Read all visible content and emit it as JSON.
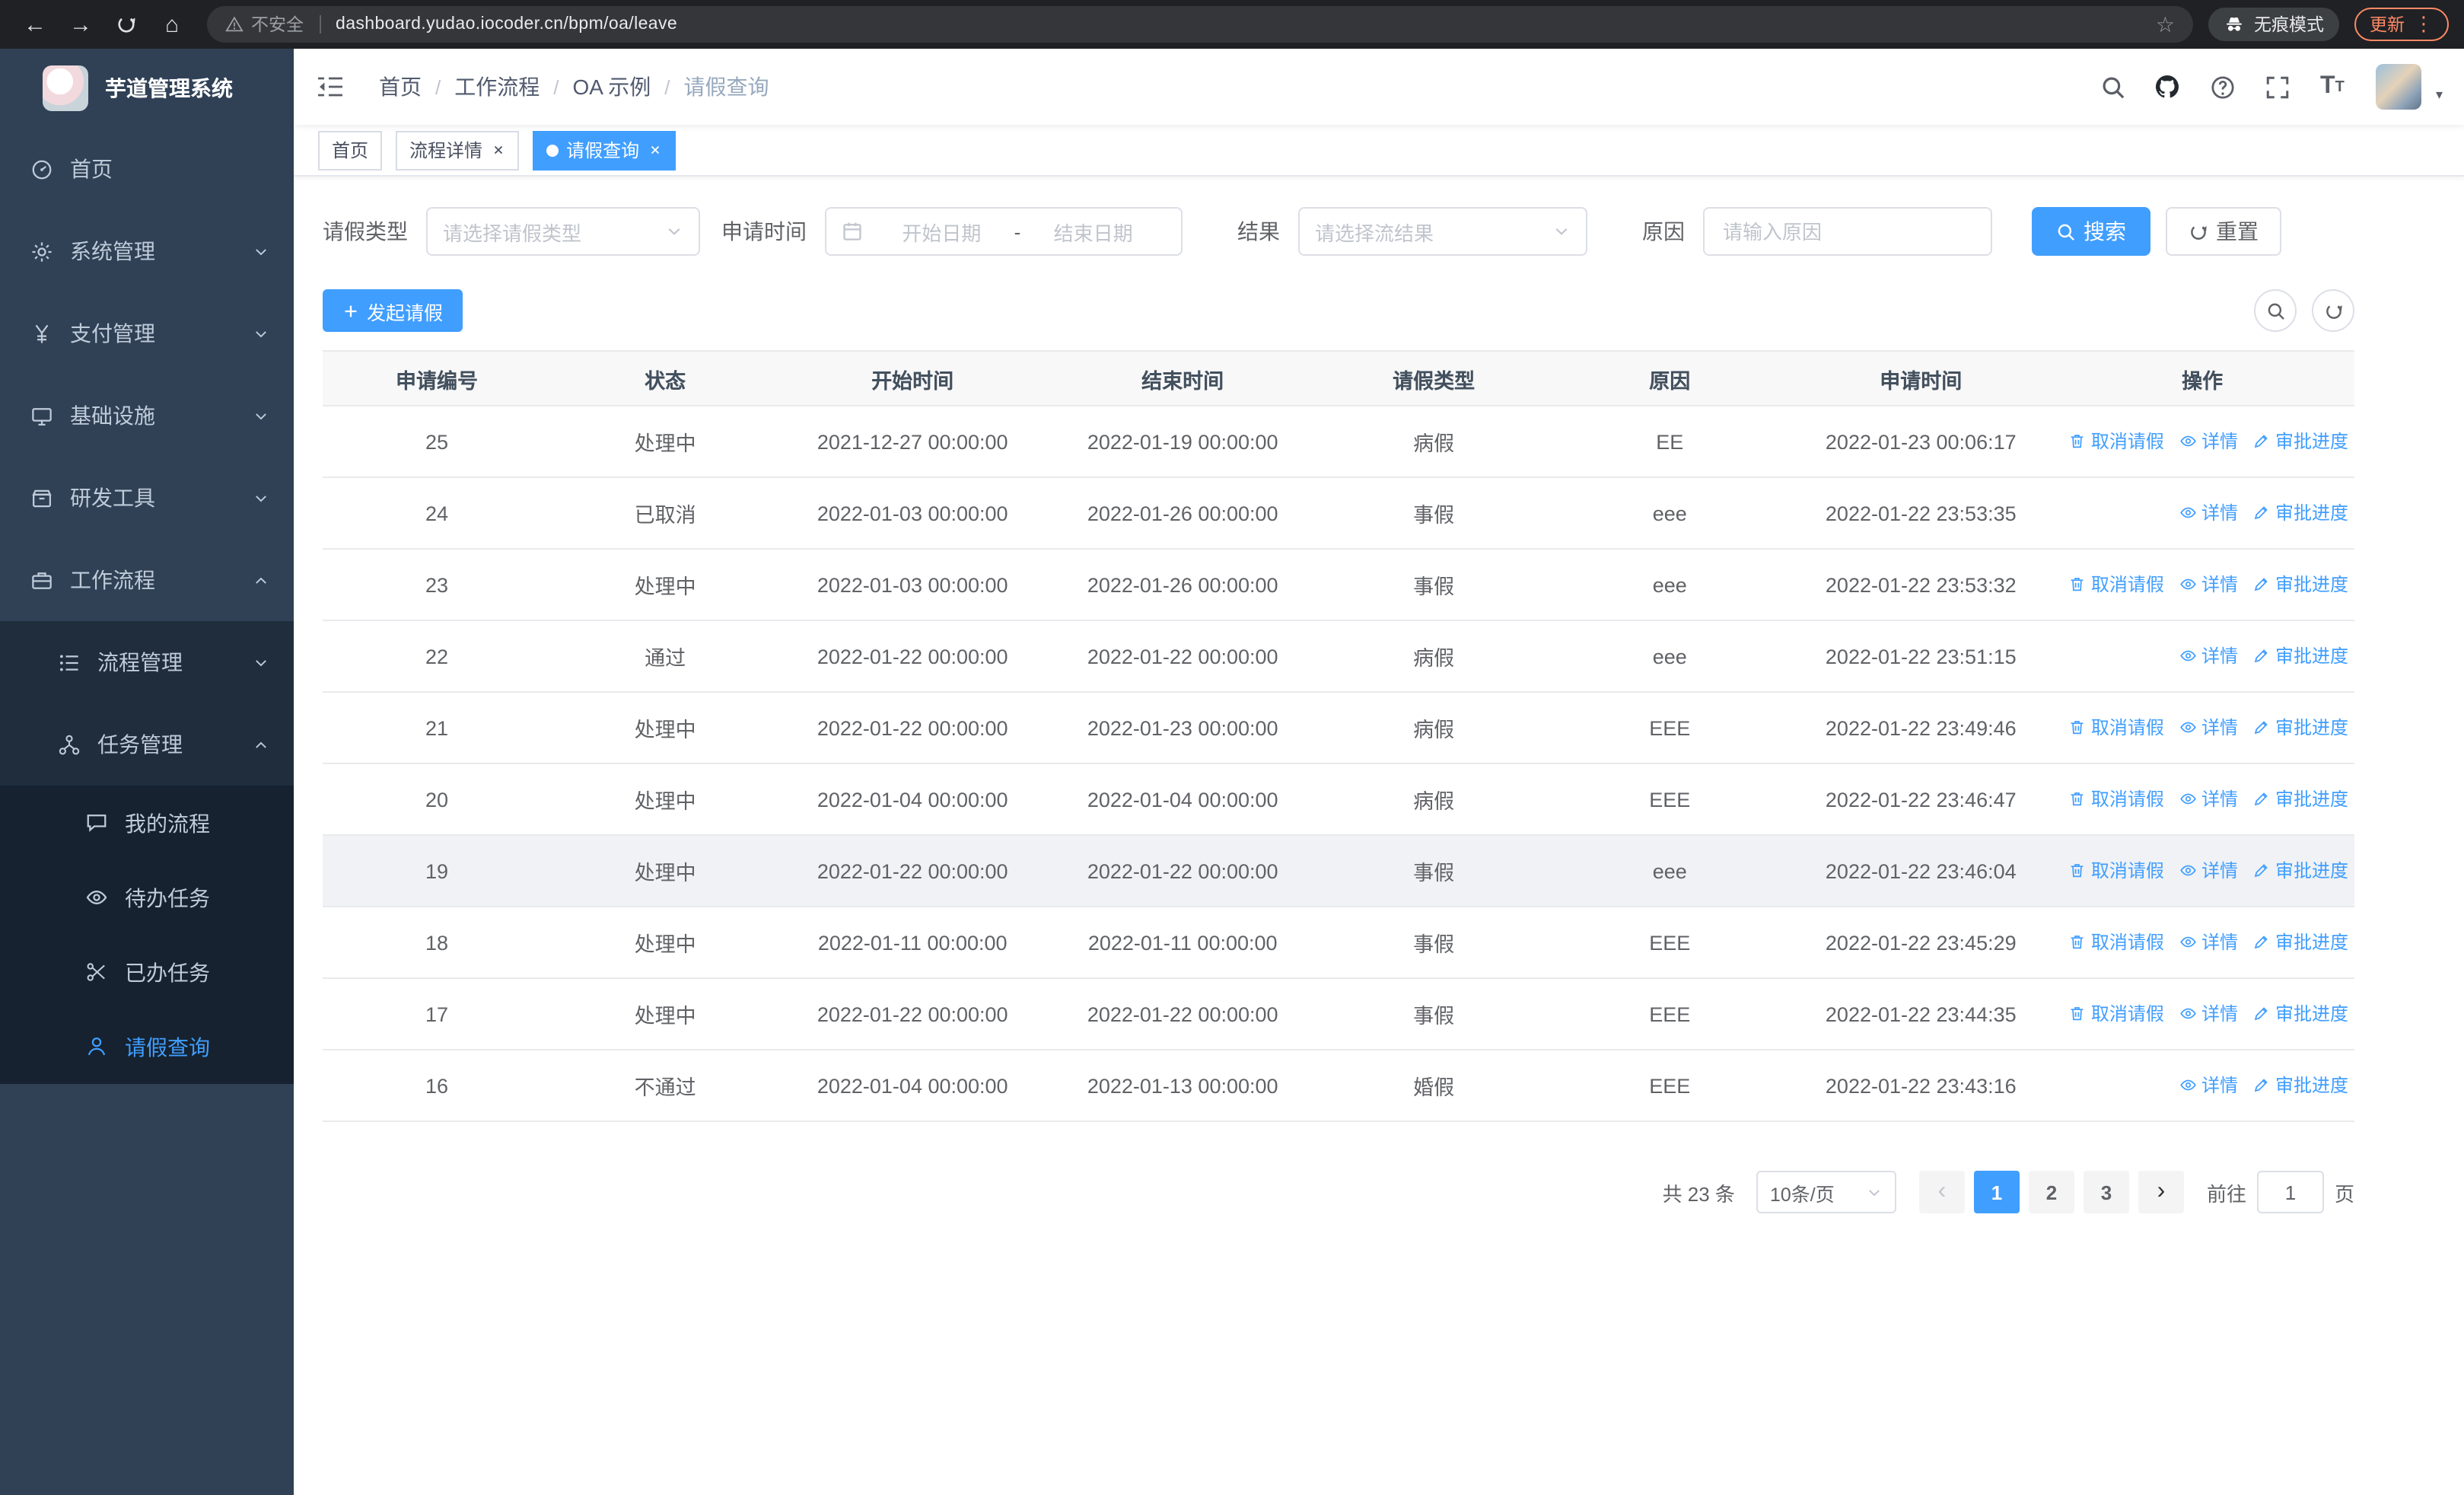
{
  "browser": {
    "security_label": "不安全",
    "url": "dashboard.yudao.iocoder.cn/bpm/oa/leave",
    "incognito_label": "无痕模式",
    "update_label": "更新"
  },
  "sidebar": {
    "logo_title": "芋道管理系统",
    "menu": [
      {
        "label": "首页",
        "icon": "dashboard-icon",
        "level": 1
      },
      {
        "label": "系统管理",
        "icon": "gear-icon",
        "level": 1,
        "chevron": "down"
      },
      {
        "label": "支付管理",
        "icon": "yen-icon",
        "level": 1,
        "chevron": "down"
      },
      {
        "label": "基础设施",
        "icon": "monitor-icon",
        "level": 1,
        "chevron": "down"
      },
      {
        "label": "研发工具",
        "icon": "tools-icon",
        "level": 1,
        "chevron": "down"
      },
      {
        "label": "工作流程",
        "icon": "workflow-icon",
        "level": 1,
        "chevron": "up"
      },
      {
        "label": "流程管理",
        "icon": "process-icon",
        "level": 2,
        "chevron": "down"
      },
      {
        "label": "任务管理",
        "icon": "task-icon",
        "level": 2,
        "chevron": "up"
      },
      {
        "label": "我的流程",
        "icon": "chat-icon",
        "level": 3
      },
      {
        "label": "待办任务",
        "icon": "eye-icon",
        "level": 3
      },
      {
        "label": "已办任务",
        "icon": "done-icon",
        "level": 3
      },
      {
        "label": "请假查询",
        "icon": "user-icon",
        "level": 3,
        "active": true
      }
    ]
  },
  "header": {
    "breadcrumb": [
      "首页",
      "工作流程",
      "OA 示例",
      "请假查询"
    ]
  },
  "tabs": [
    {
      "label": "首页",
      "active": false,
      "closable": false
    },
    {
      "label": "流程详情",
      "active": false,
      "closable": true
    },
    {
      "label": "请假查询",
      "active": true,
      "closable": true
    }
  ],
  "filters": {
    "leave_type_label": "请假类型",
    "leave_type_placeholder": "请选择请假类型",
    "apply_time_label": "申请时间",
    "start_date_placeholder": "开始日期",
    "date_separator": "-",
    "end_date_placeholder": "结束日期",
    "result_label": "结果",
    "result_placeholder": "请选择流结果",
    "reason_label": "原因",
    "reason_placeholder": "请输入原因",
    "search_label": "搜索",
    "reset_label": "重置"
  },
  "toolbar": {
    "create_label": "发起请假"
  },
  "table": {
    "columns": [
      "申请编号",
      "状态",
      "开始时间",
      "结束时间",
      "请假类型",
      "原因",
      "申请时间",
      "操作"
    ],
    "action_labels": {
      "cancel": "取消请假",
      "detail": "详情",
      "progress": "审批进度"
    },
    "rows": [
      {
        "id": "25",
        "status": "处理中",
        "start": "2021-12-27 00:00:00",
        "end": "2022-01-19 00:00:00",
        "type": "病假",
        "reason": "EE",
        "applied": "2022-01-23 00:06:17",
        "actions": [
          "cancel",
          "detail",
          "progress"
        ]
      },
      {
        "id": "24",
        "status": "已取消",
        "start": "2022-01-03 00:00:00",
        "end": "2022-01-26 00:00:00",
        "type": "事假",
        "reason": "eee",
        "applied": "2022-01-22 23:53:35",
        "actions": [
          "detail",
          "progress"
        ]
      },
      {
        "id": "23",
        "status": "处理中",
        "start": "2022-01-03 00:00:00",
        "end": "2022-01-26 00:00:00",
        "type": "事假",
        "reason": "eee",
        "applied": "2022-01-22 23:53:32",
        "actions": [
          "cancel",
          "detail",
          "progress"
        ]
      },
      {
        "id": "22",
        "status": "通过",
        "start": "2022-01-22 00:00:00",
        "end": "2022-01-22 00:00:00",
        "type": "病假",
        "reason": "eee",
        "applied": "2022-01-22 23:51:15",
        "actions": [
          "detail",
          "progress"
        ]
      },
      {
        "id": "21",
        "status": "处理中",
        "start": "2022-01-22 00:00:00",
        "end": "2022-01-23 00:00:00",
        "type": "病假",
        "reason": "EEE",
        "applied": "2022-01-22 23:49:46",
        "actions": [
          "cancel",
          "detail",
          "progress"
        ]
      },
      {
        "id": "20",
        "status": "处理中",
        "start": "2022-01-04 00:00:00",
        "end": "2022-01-04 00:00:00",
        "type": "病假",
        "reason": "EEE",
        "applied": "2022-01-22 23:46:47",
        "actions": [
          "cancel",
          "detail",
          "progress"
        ]
      },
      {
        "id": "19",
        "status": "处理中",
        "start": "2022-01-22 00:00:00",
        "end": "2022-01-22 00:00:00",
        "type": "事假",
        "reason": "eee",
        "applied": "2022-01-22 23:46:04",
        "actions": [
          "cancel",
          "detail",
          "progress"
        ],
        "hover": true
      },
      {
        "id": "18",
        "status": "处理中",
        "start": "2022-01-11 00:00:00",
        "end": "2022-01-11 00:00:00",
        "type": "事假",
        "reason": "EEE",
        "applied": "2022-01-22 23:45:29",
        "actions": [
          "cancel",
          "detail",
          "progress"
        ]
      },
      {
        "id": "17",
        "status": "处理中",
        "start": "2022-01-22 00:00:00",
        "end": "2022-01-22 00:00:00",
        "type": "事假",
        "reason": "EEE",
        "applied": "2022-01-22 23:44:35",
        "actions": [
          "cancel",
          "detail",
          "progress"
        ]
      },
      {
        "id": "16",
        "status": "不通过",
        "start": "2022-01-04 00:00:00",
        "end": "2022-01-13 00:00:00",
        "type": "婚假",
        "reason": "EEE",
        "applied": "2022-01-22 23:43:16",
        "actions": [
          "detail",
          "progress"
        ]
      }
    ]
  },
  "pagination": {
    "total_label": "共 23 条",
    "page_size": "10条/页",
    "pages": [
      "1",
      "2",
      "3"
    ],
    "active_page": "1",
    "goto_label": "前往",
    "goto_value": "1",
    "goto_suffix": "页"
  },
  "colors": {
    "primary": "#409eff",
    "sidebar_bg": "#304156",
    "submenu_bg": "#1f2d3d",
    "update_pill": "#ff8a65"
  }
}
